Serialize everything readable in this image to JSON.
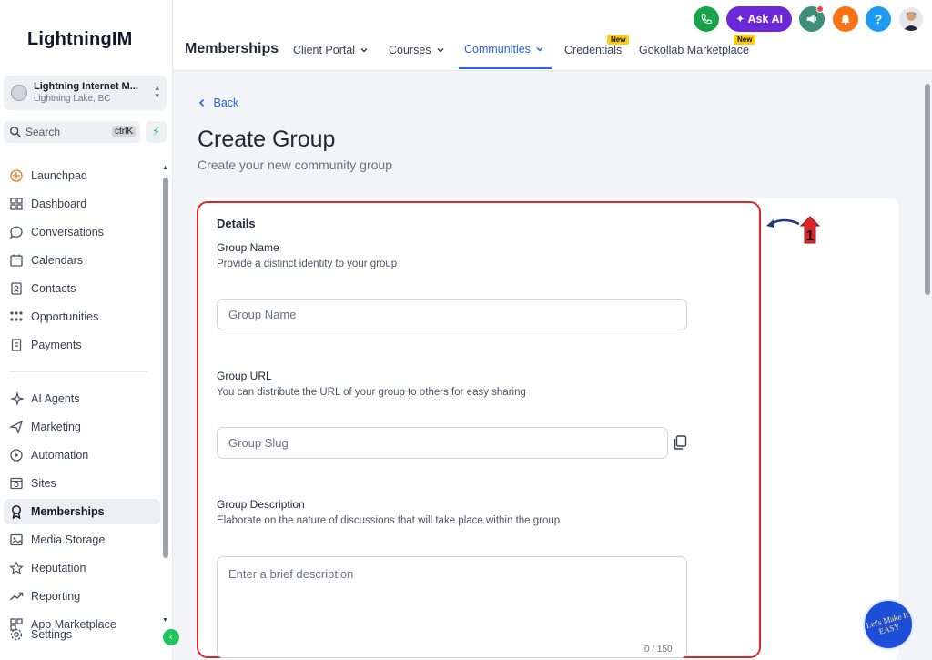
{
  "brand": {
    "logo_text": "LightningIM"
  },
  "location": {
    "name": "Lightning Internet M...",
    "sub": "Lightning Lake, BC"
  },
  "search": {
    "label": "Search",
    "shortcut": "ctrlK"
  },
  "sidebar": {
    "items": [
      {
        "label": "Launchpad",
        "icon": "rocket-icon"
      },
      {
        "label": "Dashboard",
        "icon": "grid-icon"
      },
      {
        "label": "Conversations",
        "icon": "chat-bubble-icon"
      },
      {
        "label": "Calendars",
        "icon": "calendar-icon"
      },
      {
        "label": "Contacts",
        "icon": "contact-book-icon"
      },
      {
        "label": "Opportunities",
        "icon": "pipeline-icon"
      },
      {
        "label": "Payments",
        "icon": "receipt-icon"
      },
      {
        "label": "AI Agents",
        "icon": "sparkle-icon"
      },
      {
        "label": "Marketing",
        "icon": "send-icon"
      },
      {
        "label": "Automation",
        "icon": "automation-icon"
      },
      {
        "label": "Sites",
        "icon": "browser-icon"
      },
      {
        "label": "Memberships",
        "icon": "award-icon"
      },
      {
        "label": "Media Storage",
        "icon": "image-icon"
      },
      {
        "label": "Reputation",
        "icon": "star-icon"
      },
      {
        "label": "Reporting",
        "icon": "trend-icon"
      },
      {
        "label": "App Marketplace",
        "icon": "apps-icon"
      },
      {
        "label": "Settings",
        "icon": "gear-icon"
      }
    ]
  },
  "header": {
    "title": "Memberships",
    "tabs": [
      {
        "label": "Client Portal"
      },
      {
        "label": "Courses"
      },
      {
        "label": "Communities"
      },
      {
        "label": "Credentials",
        "badge": "New"
      },
      {
        "label": "Gokollab Marketplace",
        "badge": "New"
      }
    ],
    "ask_ai": "Ask AI",
    "help": "?"
  },
  "page": {
    "back": "Back",
    "title": "Create Group",
    "subtitle": "Create your new community group"
  },
  "form": {
    "section": "Details",
    "group_name": {
      "label": "Group Name",
      "help": "Provide a distinct identity to your group",
      "placeholder": "Group Name"
    },
    "group_url": {
      "label": "Group URL",
      "help": "You can distribute the URL of your group to others for easy sharing",
      "placeholder": "Group Slug"
    },
    "group_description": {
      "label": "Group Description",
      "help": "Elaborate on the nature of discussions that will take place within the group",
      "placeholder": "Enter a brief description",
      "counter": "0 / 150"
    }
  },
  "annotation": {
    "number": "1"
  },
  "fab": {
    "text": "Let's Make It EASY"
  },
  "colors": {
    "accent": "#2563eb",
    "ask_ai": "#6d28d9",
    "highlight": "#dc2626",
    "call": "#16a34a",
    "notify": "#f97316",
    "help": "#1d9bf0"
  }
}
